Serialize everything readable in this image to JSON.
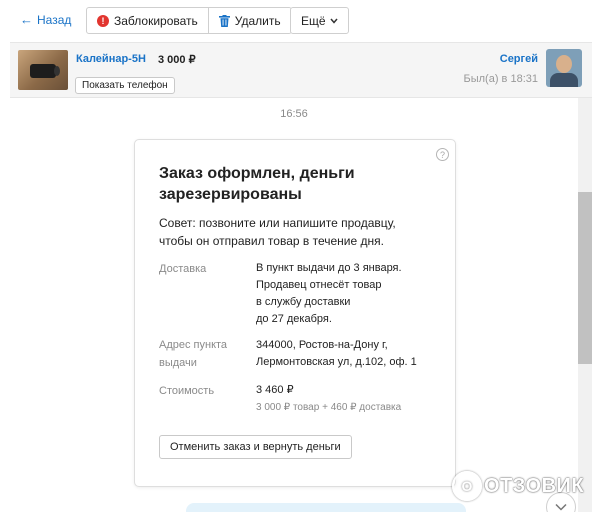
{
  "toolbar": {
    "back_label": "Назад",
    "block_label": "Заблокировать",
    "delete_label": "Удалить",
    "more_label": "Ещё"
  },
  "header": {
    "item_title": "Калейнар-5Н",
    "item_price": "3 000 ₽",
    "phone_button": "Показать телефон",
    "seller_name": "Сергей",
    "seller_status": "Был(а) в 18:31"
  },
  "chat": {
    "time": "16:56",
    "card": {
      "title": "Заказ оформлен, деньги зарезервированы",
      "advice": "Совет: позвоните или напишите продавцу, чтобы он отправил товар в течение дня.",
      "delivery_label": "Доставка",
      "delivery_lines": [
        "В пункт выдачи до 3 января.",
        "Продавец отнесёт товар",
        "в службу доставки",
        "до 27 декабря."
      ],
      "address_label_lines": [
        "Адрес пункта",
        "выдачи"
      ],
      "address_lines": [
        "344000, Ростов-на-Дону г,",
        "Лермонтовская ул, д.102, оф. 1"
      ],
      "cost_label": "Стоимость",
      "cost_total": "3 460 ₽",
      "cost_breakdown": "3 000 ₽ товар + 460 ₽ доставка",
      "cancel_button": "Отменить заказ и вернуть деньги",
      "help_glyph": "?"
    }
  },
  "watermark": {
    "logo_glyph": "О",
    "text": "ОТЗОВИК"
  },
  "colors": {
    "link": "#1a73c7",
    "block_icon": "#e2352f",
    "header_bg": "#f5f5f5",
    "bubble": "#e3f2fb"
  },
  "icons": [
    "back-arrow-icon",
    "block-icon",
    "trash-icon",
    "chevron-down-icon",
    "help-icon",
    "scroll-down-icon"
  ]
}
